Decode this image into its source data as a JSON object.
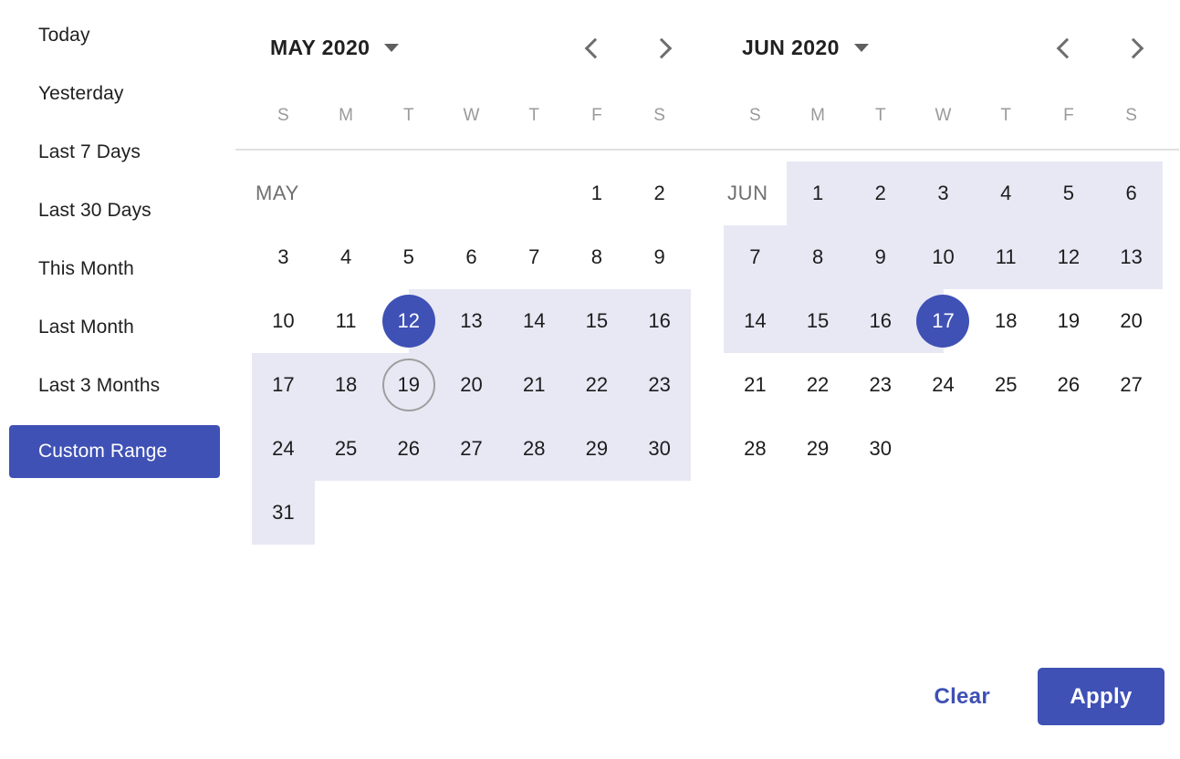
{
  "colors": {
    "accent": "#3f51b5",
    "range_highlight": "#e8e8f5",
    "today_ring": "#9e9e9e",
    "weekday_text": "#9a9a9a",
    "separator": "#e0e0e0"
  },
  "sidebar": {
    "items": [
      {
        "label": "Today",
        "active": false
      },
      {
        "label": "Yesterday",
        "active": false
      },
      {
        "label": "Last 7 Days",
        "active": false
      },
      {
        "label": "Last 30 Days",
        "active": false
      },
      {
        "label": "This Month",
        "active": false
      },
      {
        "label": "Last Month",
        "active": false
      },
      {
        "label": "Last 3 Months",
        "active": false
      },
      {
        "label": "Custom Range",
        "active": true
      }
    ]
  },
  "weekday_headers": [
    "S",
    "M",
    "T",
    "W",
    "T",
    "F",
    "S"
  ],
  "calendars": [
    {
      "title": "MAY 2020",
      "month_abbr": "MAY",
      "dropdown_icon": "caret-down-icon",
      "prev_icon": "chevron-left-icon",
      "next_icon": "chevron-right-icon",
      "first_weekday_index": 5,
      "days_in_month": 31,
      "cells": [
        {
          "label": "MAY",
          "type": "month-label"
        },
        {
          "label": "",
          "type": "empty"
        },
        {
          "label": "",
          "type": "empty"
        },
        {
          "label": "",
          "type": "empty"
        },
        {
          "label": "",
          "type": "empty"
        },
        {
          "label": "1",
          "type": "day"
        },
        {
          "label": "2",
          "type": "day"
        },
        {
          "label": "3",
          "type": "day"
        },
        {
          "label": "4",
          "type": "day"
        },
        {
          "label": "5",
          "type": "day"
        },
        {
          "label": "6",
          "type": "day"
        },
        {
          "label": "7",
          "type": "day"
        },
        {
          "label": "8",
          "type": "day"
        },
        {
          "label": "9",
          "type": "day"
        },
        {
          "label": "10",
          "type": "day"
        },
        {
          "label": "11",
          "type": "day"
        },
        {
          "label": "12",
          "type": "day",
          "selected": true,
          "in_range": true,
          "range_start": true
        },
        {
          "label": "13",
          "type": "day",
          "in_range": true
        },
        {
          "label": "14",
          "type": "day",
          "in_range": true
        },
        {
          "label": "15",
          "type": "day",
          "in_range": true
        },
        {
          "label": "16",
          "type": "day",
          "in_range": true
        },
        {
          "label": "17",
          "type": "day",
          "in_range": true
        },
        {
          "label": "18",
          "type": "day",
          "in_range": true
        },
        {
          "label": "19",
          "type": "day",
          "in_range": true,
          "today": true
        },
        {
          "label": "20",
          "type": "day",
          "in_range": true
        },
        {
          "label": "21",
          "type": "day",
          "in_range": true
        },
        {
          "label": "22",
          "type": "day",
          "in_range": true
        },
        {
          "label": "23",
          "type": "day",
          "in_range": true
        },
        {
          "label": "24",
          "type": "day",
          "in_range": true
        },
        {
          "label": "25",
          "type": "day",
          "in_range": true
        },
        {
          "label": "26",
          "type": "day",
          "in_range": true
        },
        {
          "label": "27",
          "type": "day",
          "in_range": true
        },
        {
          "label": "28",
          "type": "day",
          "in_range": true
        },
        {
          "label": "29",
          "type": "day",
          "in_range": true
        },
        {
          "label": "30",
          "type": "day",
          "in_range": true
        },
        {
          "label": "31",
          "type": "day",
          "in_range": true
        },
        {
          "label": "",
          "type": "empty"
        },
        {
          "label": "",
          "type": "empty"
        },
        {
          "label": "",
          "type": "empty"
        },
        {
          "label": "",
          "type": "empty"
        },
        {
          "label": "",
          "type": "empty"
        },
        {
          "label": "",
          "type": "empty"
        }
      ]
    },
    {
      "title": "JUN 2020",
      "month_abbr": "JUN",
      "dropdown_icon": "caret-down-icon",
      "prev_icon": "chevron-left-icon",
      "next_icon": "chevron-right-icon",
      "first_weekday_index": 1,
      "days_in_month": 30,
      "cells": [
        {
          "label": "JUN",
          "type": "month-label"
        },
        {
          "label": "1",
          "type": "day",
          "in_range": true
        },
        {
          "label": "2",
          "type": "day",
          "in_range": true
        },
        {
          "label": "3",
          "type": "day",
          "in_range": true
        },
        {
          "label": "4",
          "type": "day",
          "in_range": true
        },
        {
          "label": "5",
          "type": "day",
          "in_range": true
        },
        {
          "label": "6",
          "type": "day",
          "in_range": true
        },
        {
          "label": "7",
          "type": "day",
          "in_range": true
        },
        {
          "label": "8",
          "type": "day",
          "in_range": true
        },
        {
          "label": "9",
          "type": "day",
          "in_range": true
        },
        {
          "label": "10",
          "type": "day",
          "in_range": true
        },
        {
          "label": "11",
          "type": "day",
          "in_range": true
        },
        {
          "label": "12",
          "type": "day",
          "in_range": true
        },
        {
          "label": "13",
          "type": "day",
          "in_range": true
        },
        {
          "label": "14",
          "type": "day",
          "in_range": true
        },
        {
          "label": "15",
          "type": "day",
          "in_range": true
        },
        {
          "label": "16",
          "type": "day",
          "in_range": true
        },
        {
          "label": "17",
          "type": "day",
          "selected": true,
          "in_range": true,
          "range_end": true
        },
        {
          "label": "18",
          "type": "day"
        },
        {
          "label": "19",
          "type": "day"
        },
        {
          "label": "20",
          "type": "day"
        },
        {
          "label": "21",
          "type": "day"
        },
        {
          "label": "22",
          "type": "day"
        },
        {
          "label": "23",
          "type": "day"
        },
        {
          "label": "24",
          "type": "day"
        },
        {
          "label": "25",
          "type": "day"
        },
        {
          "label": "26",
          "type": "day"
        },
        {
          "label": "27",
          "type": "day"
        },
        {
          "label": "28",
          "type": "day"
        },
        {
          "label": "29",
          "type": "day"
        },
        {
          "label": "30",
          "type": "day"
        },
        {
          "label": "",
          "type": "empty"
        },
        {
          "label": "",
          "type": "empty"
        },
        {
          "label": "",
          "type": "empty"
        },
        {
          "label": "",
          "type": "empty"
        }
      ]
    }
  ],
  "footer": {
    "clear_label": "Clear",
    "apply_label": "Apply"
  },
  "selection": {
    "start_date": "May 12, 2020",
    "end_date": "Jun 17, 2020",
    "today": "May 19, 2020"
  }
}
